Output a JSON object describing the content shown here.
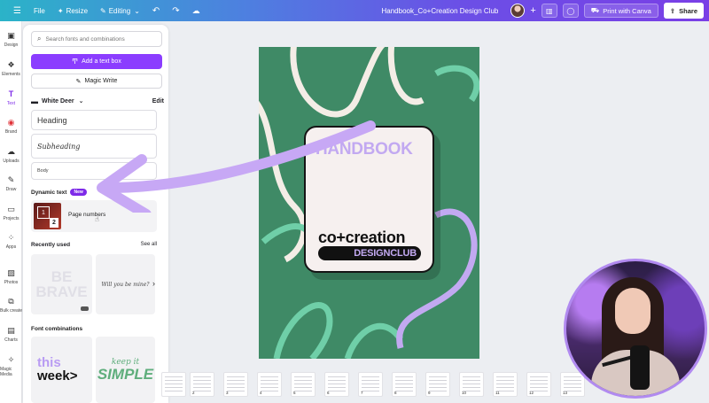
{
  "topbar": {
    "file": "File",
    "resize": "Resize",
    "editing": "Editing",
    "doc_title": "Handbook_Co+Creation Design Club",
    "print": "Print with Canva",
    "share": "Share"
  },
  "rail": [
    {
      "label": "Design",
      "icon": "design-icon"
    },
    {
      "label": "Elements",
      "icon": "elements-icon"
    },
    {
      "label": "Text",
      "icon": "text-icon"
    },
    {
      "label": "Brand",
      "icon": "brand-icon"
    },
    {
      "label": "Uploads",
      "icon": "uploads-icon"
    },
    {
      "label": "Draw",
      "icon": "draw-icon"
    },
    {
      "label": "Projects",
      "icon": "projects-icon"
    },
    {
      "label": "Apps",
      "icon": "apps-icon"
    },
    {
      "label": "Photos",
      "icon": "photos-icon"
    },
    {
      "label": "Bulk create",
      "icon": "bulk-create-icon"
    },
    {
      "label": "Charts",
      "icon": "charts-icon"
    },
    {
      "label": "Magic Media",
      "icon": "magic-media-icon"
    }
  ],
  "panel": {
    "search_placeholder": "Search fonts and combinations",
    "add_text": "Add a text box",
    "magic_write": "Magic Write",
    "brand_kit": "White Deer",
    "edit": "Edit",
    "heading": "Heading",
    "subheading": "Subheading",
    "body": "Body",
    "dynamic_text": "Dynamic text",
    "new_badge": "New",
    "page_numbers": "Page numbers",
    "page_number_thumb_a": "1",
    "page_number_thumb_b": "2",
    "recently_used": "Recently used",
    "see_all": "See all",
    "recent1_line1": "BE",
    "recent1_line2": "BRAVE",
    "recent2": "Will you be mine?",
    "font_combinations": "Font combinations",
    "combo1_line1": "this",
    "combo1_line2": "week>",
    "combo2_line1": "keep it",
    "combo2_line2": "SIMPLE"
  },
  "canvas": {
    "title": "HANDBOOK",
    "brand_line1": "co+creation",
    "brand_line2": "DESIGNCLUB"
  },
  "pages": [
    "2",
    "3",
    "4",
    "5",
    "6",
    "7",
    "8",
    "9",
    "10",
    "11",
    "12",
    "13",
    "14"
  ],
  "colors": {
    "accent": "#8b3dff",
    "page_bg": "#3f8a66",
    "lavender": "#c2a9f1",
    "mint": "#7dd3b0"
  }
}
